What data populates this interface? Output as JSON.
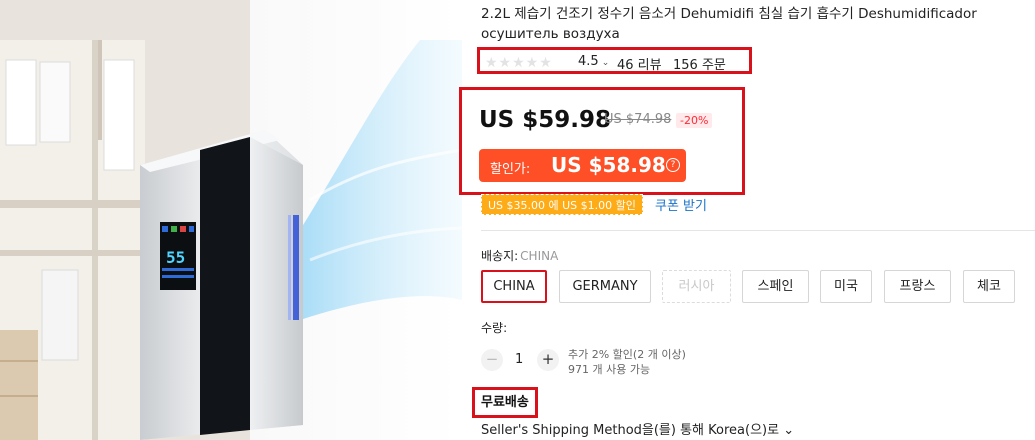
{
  "product": {
    "title": "2.2L 제습기 건조기 정수기 음소거 Dehumidifi 침실 습기 흡수기 Deshumidificador осушитель воздуха"
  },
  "rating": {
    "stars": "★★★★★",
    "value": "4.5",
    "chevron": "⌄",
    "reviews": "46 리뷰",
    "orders": "156 주문"
  },
  "price": {
    "current": "US $59.98",
    "original": "US $74.98",
    "discount": "-20%",
    "sale_label": "할인가:",
    "sale_price": "US $58.98",
    "help": "?"
  },
  "coupon": {
    "text": "US $35.00 에 US $1.00 할인",
    "link": "쿠폰 받기"
  },
  "shipping_from": {
    "label": "배송지:",
    "value": "CHINA",
    "options": [
      "CHINA",
      "GERMANY",
      "러시아",
      "스페인",
      "미국",
      "프랑스",
      "체코"
    ]
  },
  "quantity": {
    "label": "수량:",
    "minus": "−",
    "value": "1",
    "plus": "+",
    "bulk_discount": "추가 2% 할인(2 개 이상)",
    "available": "971 개 사용 가능"
  },
  "shipping": {
    "free": "무료배송",
    "method": "Seller's Shipping Method을(를) 통해 Korea(으)로 ⌄"
  },
  "device": {
    "display_digits": "55"
  },
  "colors": {
    "accent_red": "#d8111a",
    "sale_orange": "#fe4f27",
    "coupon_orange": "#fdab17",
    "link_blue": "#1a73c9"
  }
}
